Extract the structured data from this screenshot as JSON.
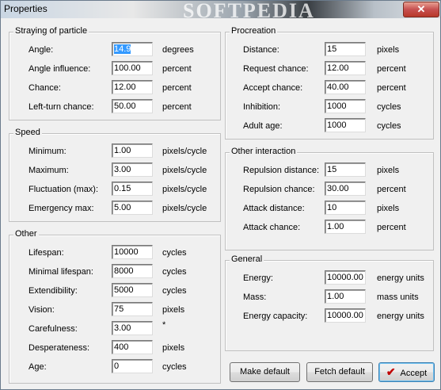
{
  "window": {
    "title": "Properties",
    "watermark": "SOFTPEDIA",
    "close_label": "✕"
  },
  "groups": {
    "straying": {
      "title": "Straying of particle",
      "rows": [
        {
          "label": "Angle:",
          "value": "14.9",
          "unit": "degrees"
        },
        {
          "label": "Angle influence:",
          "value": "100.00",
          "unit": "percent"
        },
        {
          "label": "Chance:",
          "value": "12.00",
          "unit": "percent"
        },
        {
          "label": "Left-turn chance:",
          "value": "50.00",
          "unit": "percent"
        }
      ]
    },
    "speed": {
      "title": "Speed",
      "rows": [
        {
          "label": "Minimum:",
          "value": "1.00",
          "unit": "pixels/cycle"
        },
        {
          "label": "Maximum:",
          "value": "3.00",
          "unit": "pixels/cycle"
        },
        {
          "label": "Fluctuation (max):",
          "value": "0.15",
          "unit": "pixels/cycle"
        },
        {
          "label": "Emergency max:",
          "value": "5.00",
          "unit": "pixels/cycle"
        }
      ]
    },
    "other": {
      "title": "Other",
      "rows": [
        {
          "label": "Lifespan:",
          "value": "10000",
          "unit": "cycles"
        },
        {
          "label": "Minimal lifespan:",
          "value": "8000",
          "unit": "cycles"
        },
        {
          "label": "Extendibility:",
          "value": "5000",
          "unit": "cycles"
        },
        {
          "label": "Vision:",
          "value": "75",
          "unit": "pixels"
        },
        {
          "label": "Carefulness:",
          "value": "3.00",
          "unit": "*"
        },
        {
          "label": "Desperateness:",
          "value": "400",
          "unit": "pixels"
        },
        {
          "label": "Age:",
          "value": "0",
          "unit": "cycles"
        }
      ]
    },
    "procreation": {
      "title": "Procreation",
      "rows": [
        {
          "label": "Distance:",
          "value": "15",
          "unit": "pixels"
        },
        {
          "label": "Request chance:",
          "value": "12.00",
          "unit": "percent"
        },
        {
          "label": "Accept chance:",
          "value": "40.00",
          "unit": "percent"
        },
        {
          "label": "Inhibition:",
          "value": "1000",
          "unit": "cycles"
        },
        {
          "label": "Adult age:",
          "value": "1000",
          "unit": "cycles"
        }
      ]
    },
    "interaction": {
      "title": "Other interaction",
      "rows": [
        {
          "label": "Repulsion distance:",
          "value": "15",
          "unit": "pixels"
        },
        {
          "label": "Repulsion chance:",
          "value": "30.00",
          "unit": "percent"
        },
        {
          "label": "Attack distance:",
          "value": "10",
          "unit": "pixels"
        },
        {
          "label": "Attack chance:",
          "value": "1.00",
          "unit": "percent"
        }
      ]
    },
    "general": {
      "title": "General",
      "rows": [
        {
          "label": "Energy:",
          "value": "10000.00",
          "unit": "energy units"
        },
        {
          "label": "Mass:",
          "value": "1.00",
          "unit": "mass units"
        },
        {
          "label": "Energy capacity:",
          "value": "10000.00",
          "unit": "energy units"
        }
      ]
    }
  },
  "buttons": {
    "make_default": "Make default",
    "fetch_default": "Fetch default",
    "accept": "Accept"
  }
}
